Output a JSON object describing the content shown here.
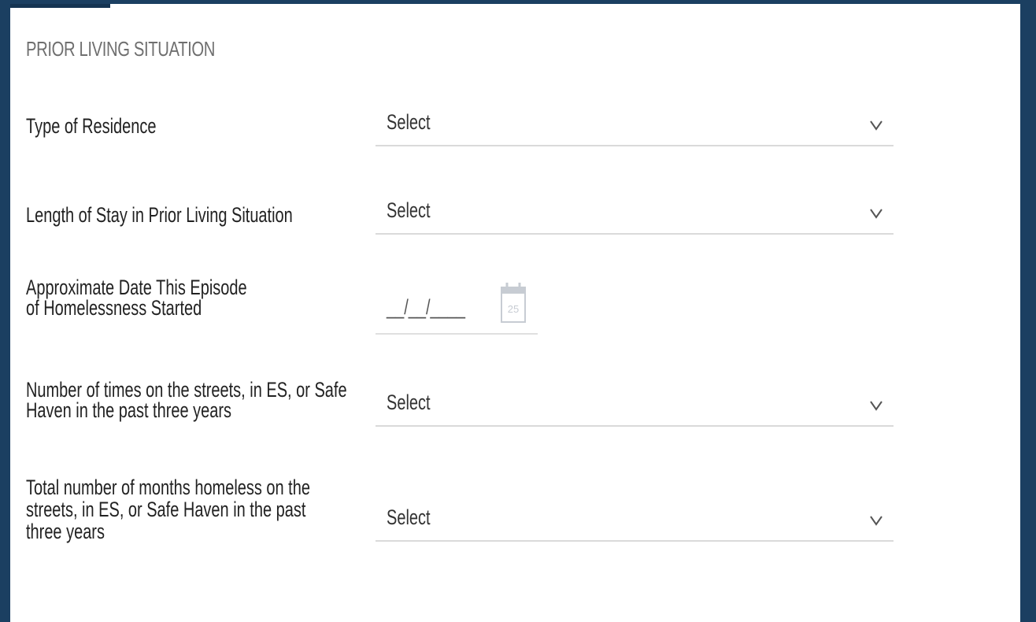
{
  "section": {
    "title": "PRIOR LIVING SITUATION"
  },
  "fields": {
    "type_of_residence": {
      "label": "Type of Residence",
      "value": "Select"
    },
    "length_of_stay": {
      "label": "Length of Stay in Prior Living Situation",
      "value": "Select"
    },
    "episode_start": {
      "label": "Approximate Date This Episode of Homelessness Started",
      "value": "__/__/____",
      "calendar_day": "25"
    },
    "times_on_streets": {
      "label": "Number of times on the streets, in ES, or Safe Haven in the past three years",
      "value": "Select"
    },
    "months_homeless": {
      "label": "Total number of months homeless on the streets, in ES, or Safe Haven in the past three years",
      "value": "Select"
    }
  },
  "icons": {
    "dropdown": "chevron-down-icon",
    "date": "calendar-icon"
  },
  "colors": {
    "frame": "#1b3f61",
    "panel": "#ffffff",
    "underline": "#dadada"
  }
}
